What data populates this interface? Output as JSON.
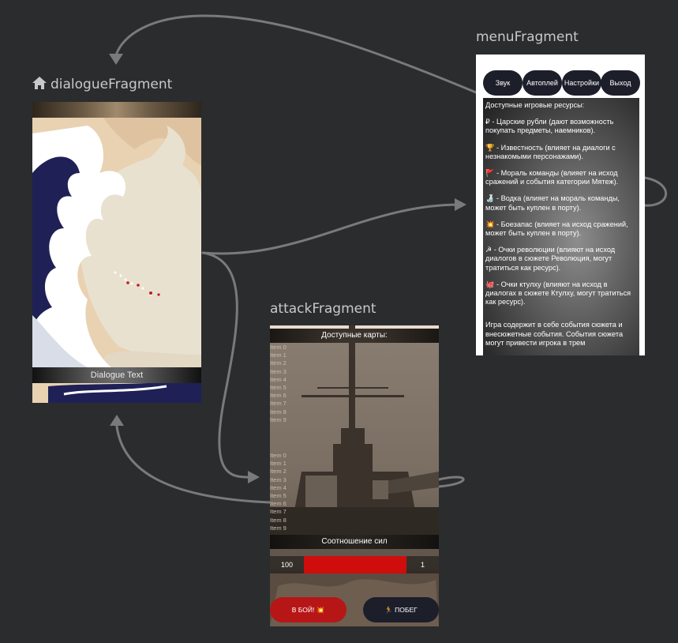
{
  "colors": {
    "canvas": "#2b2c2e",
    "arrow": "#7a7a7a",
    "label": "#c9c9c9",
    "tab_bg": "#1c1e2a",
    "progress_red": "#cf0d0d",
    "fight_button": "#b71616"
  },
  "dialogue": {
    "label": "dialogueFragment",
    "icon": "home-icon",
    "text": "Dialogue Text"
  },
  "menu": {
    "label": "menuFragment",
    "tabs": [
      "Звук",
      "Автоплей",
      "Настройки",
      "Выход"
    ],
    "lines": [
      "Доступные игровые ресурсы:",
      "₽ - Царские рубли (дают возможность покупать предметы, наемников).",
      "🏆 - Известность (влияет на диалоги с незнакомыми персонажами).",
      "🚩 - Мораль команды (влияет на исход сражений и события категории Мятеж).",
      "🍶 - Водка (влияет на мораль команды, может быть куплен в порту).",
      "💥 - Боезапас (влияет на исход сражений, может быть куплен в порту).",
      "☭ - Очки революции (влияют на исход диалогов в сюжете Революция, могут тратиться как ресурс).",
      "🐙 - Очки ктулху (влияют на исход в диалогах в сюжете Ктулху, могут тратиться как ресурс).",
      "Игра содержит в себе события сюжета и внесюжетные события. События сюжета могут привести игрока в трем"
    ]
  },
  "attack": {
    "label": "attackFragment",
    "title": "Доступные карты:",
    "items_top": [
      "Item 0",
      "Item 1",
      "Item 2",
      "Item 3",
      "Item 4",
      "Item 5",
      "Item 6",
      "Item 7",
      "Item 8",
      "Item 9"
    ],
    "items_bottom": [
      "Item 0",
      "Item 1",
      "Item 2",
      "Item 3",
      "Item 4",
      "Item 5",
      "Item 6",
      "Item 7",
      "Item 8",
      "Item 9"
    ],
    "force_label": "Соотношение сил",
    "left_value": "100",
    "right_value": "1",
    "fight_button": "В БОЙ! 💥",
    "flee_button": "🏃 ПОБЕГ"
  }
}
